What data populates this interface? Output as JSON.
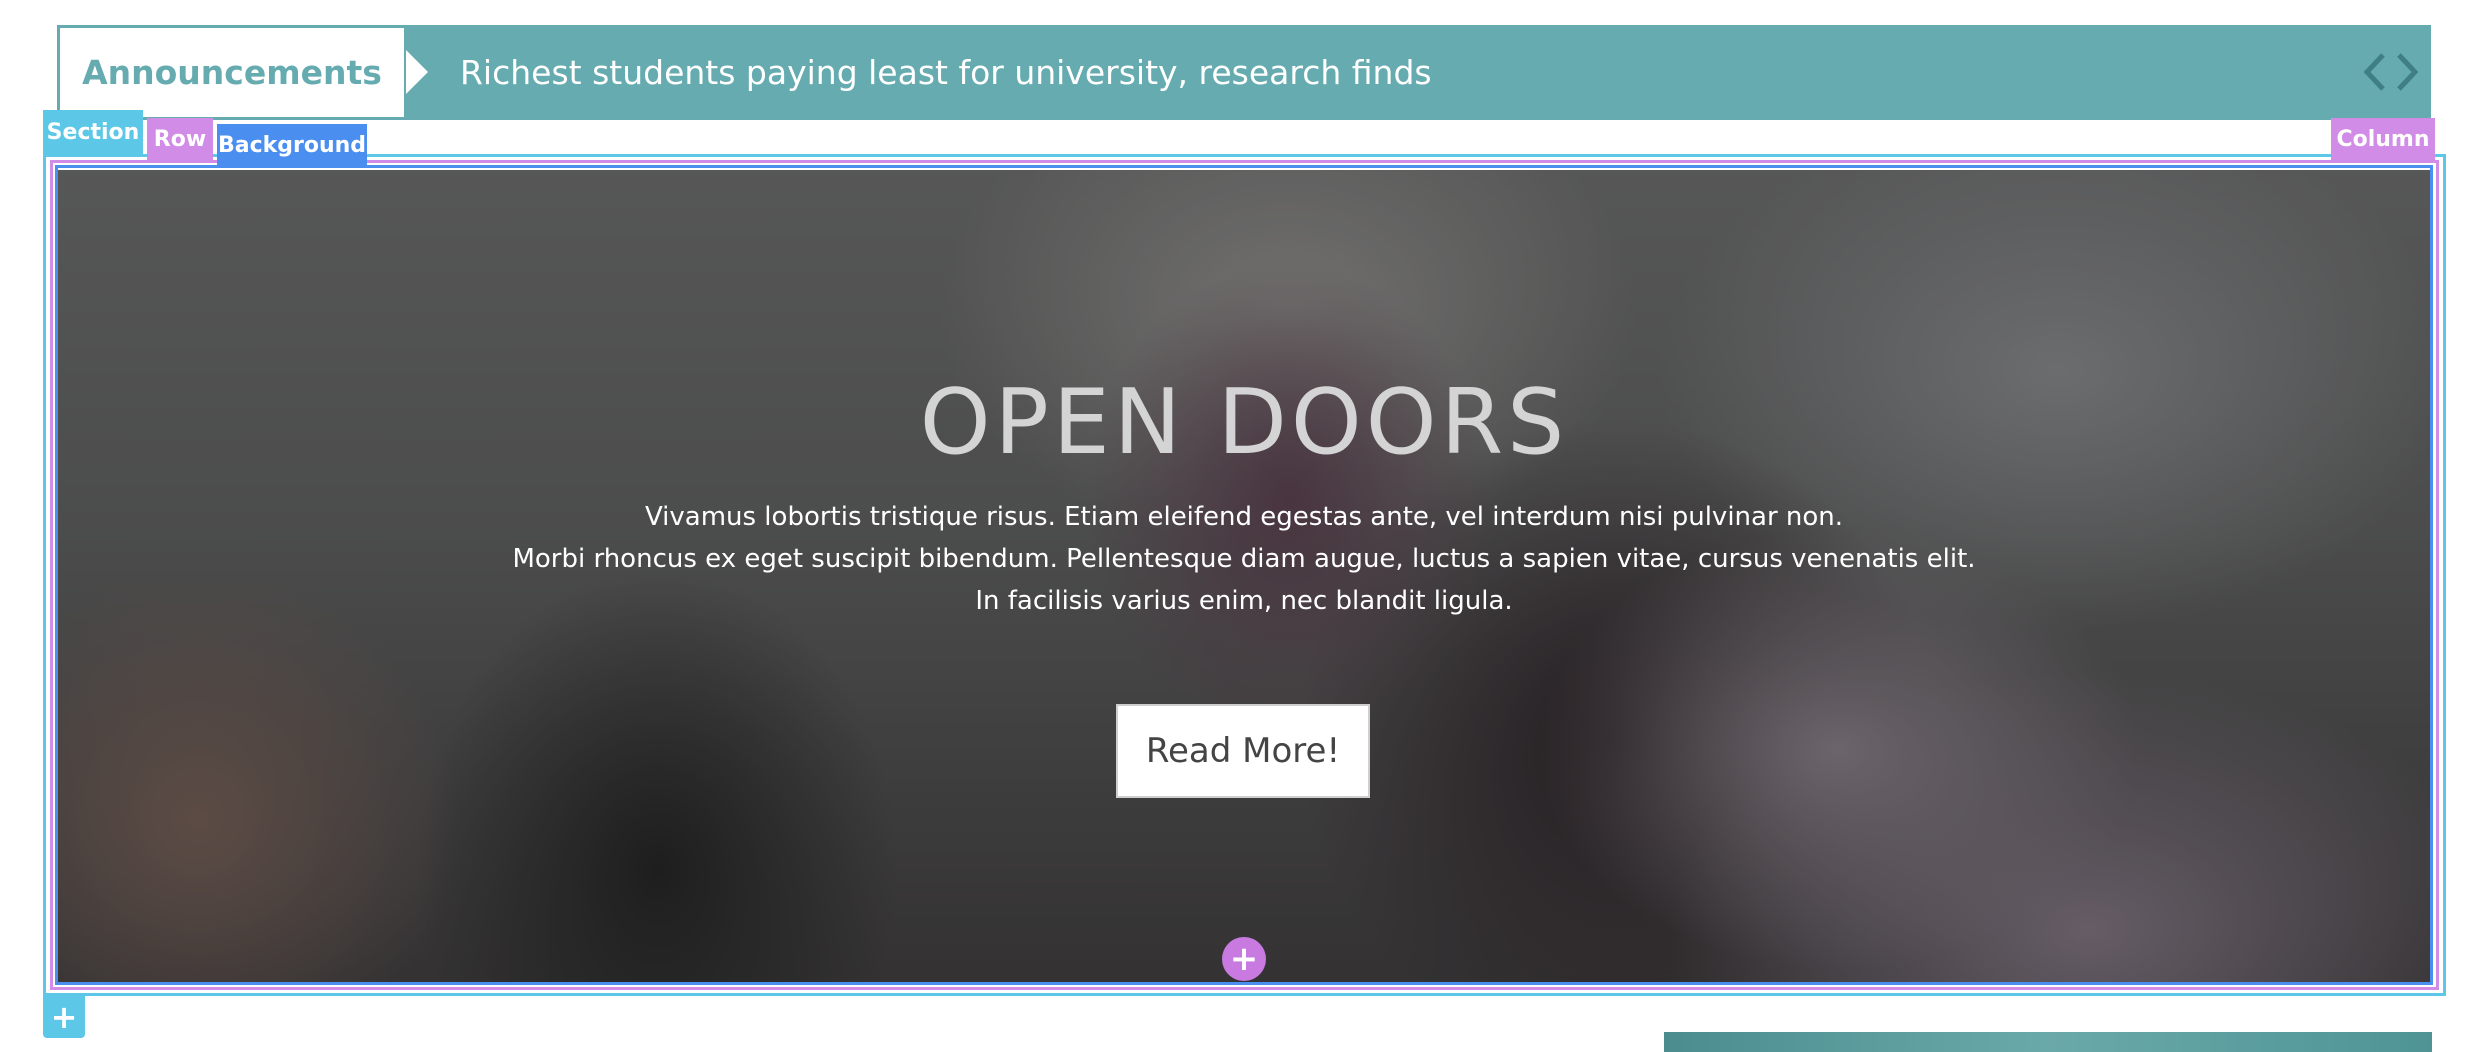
{
  "announcements": {
    "label": "Announcements",
    "headline": "Richest students paying least for university, research finds",
    "prev_icon": "chevron-left-icon",
    "next_icon": "chevron-right-icon"
  },
  "builder": {
    "section_tag": "Section",
    "row_tag": "Row",
    "background_tag": "Background",
    "column_tag": "Column",
    "add_row_icon": "plus-icon",
    "add_section_icon": "plus-icon",
    "add_row_symbol": "+",
    "add_section_symbol": "+"
  },
  "hero": {
    "title": "OPEN DOORS",
    "lines": [
      "Vivamus lobortis tristique risus. Etiam eleifend egestas ante, vel interdum nisi pulvinar non.",
      "Morbi rhoncus ex eget suscipit bibendum. Pellentesque diam augue, luctus a sapien vitae, cursus venenatis elit.",
      "In facilisis varius enim, nec blandit ligula."
    ],
    "button_label": "Read More!"
  },
  "colors": {
    "accent": "#65abb0",
    "section_outline": "#5cc7e6",
    "row_outline": "#d08ce6",
    "background_outline": "#4a8ff0"
  }
}
